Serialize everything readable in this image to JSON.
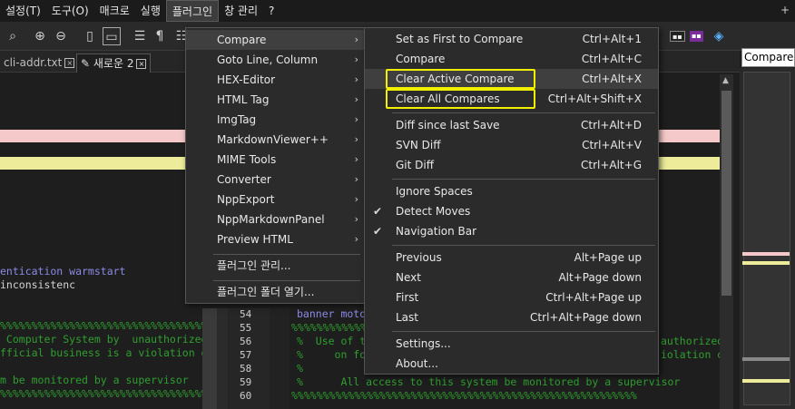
{
  "menubar": {
    "items": [
      "설정(T)",
      "도구(O)",
      "매크로",
      "실행",
      "플러그인",
      "창 관리",
      "?"
    ],
    "plus": "+"
  },
  "tabs": [
    {
      "label": "cli-addr.txt"
    },
    {
      "label": "새로운 2"
    }
  ],
  "compare_panel_tab": "Compare Pa",
  "plugin_menu": {
    "items": [
      {
        "label": "Compare",
        "submenu": true
      },
      {
        "label": "Goto Line, Column",
        "submenu": true
      },
      {
        "label": "HEX-Editor",
        "submenu": true
      },
      {
        "label": "HTML Tag",
        "submenu": true
      },
      {
        "label": "ImgTag",
        "submenu": true
      },
      {
        "label": "MarkdownViewer++",
        "submenu": true
      },
      {
        "label": "MIME Tools",
        "submenu": true
      },
      {
        "label": "Converter",
        "submenu": true
      },
      {
        "label": "NppExport",
        "submenu": true
      },
      {
        "label": "NppMarkdownPanel",
        "submenu": true
      },
      {
        "label": "Preview HTML",
        "submenu": true
      },
      {
        "label": "플러그인 관리...",
        "submenu": false
      },
      {
        "label": "플러그인 폴더 열기...",
        "submenu": false
      }
    ]
  },
  "compare_menu": {
    "items": [
      {
        "label": "Set as First to Compare",
        "shortcut": "Ctrl+Alt+1"
      },
      {
        "label": "Compare",
        "shortcut": "Ctrl+Alt+C"
      },
      {
        "label": "Clear Active Compare",
        "shortcut": "Ctrl+Alt+X"
      },
      {
        "label": "Clear All Compares",
        "shortcut": "Ctrl+Alt+Shift+X"
      },
      {
        "label": "Diff since last Save",
        "shortcut": "Ctrl+Alt+D"
      },
      {
        "label": "SVN Diff",
        "shortcut": "Ctrl+Alt+V"
      },
      {
        "label": "Git Diff",
        "shortcut": "Ctrl+Alt+G"
      },
      {
        "label": "Ignore Spaces",
        "shortcut": "",
        "checked": false
      },
      {
        "label": "Detect Moves",
        "shortcut": "",
        "checked": true
      },
      {
        "label": "Navigation Bar",
        "shortcut": "",
        "checked": true
      },
      {
        "label": "Previous",
        "shortcut": "Alt+Page up"
      },
      {
        "label": "Next",
        "shortcut": "Alt+Page down"
      },
      {
        "label": "First",
        "shortcut": "Ctrl+Alt+Page up"
      },
      {
        "label": "Last",
        "shortcut": "Ctrl+Alt+Page down"
      },
      {
        "label": "Settings...",
        "shortcut": ""
      },
      {
        "label": "About...",
        "shortcut": ""
      }
    ]
  },
  "editor": {
    "left_lines": [
      "entication warmstart",
      "inconsistenc",
      "%%%%%%%%%%%%%%%%%%%%%%%%%%%%%%%%%%%%%%%%%%%%%%%%%%%%%%%",
      " Computer System by  unauthorized",
      "fficial business is a violation o",
      "",
      "m be monitored by a supervisor",
      "%%%%%%%%%%%%%%%%%%%%%%%%%%%%%%%%%%%%%%%%%%%%%%%%%%%%%%%"
    ],
    "line_numbers": [
      "54",
      "55",
      "56",
      "57",
      "58",
      "59",
      "60"
    ],
    "right_lines": [
      "banner moto",
      "%%%%%%%%%%%%%%%%%%%%%%%%%%%%%%%%%%%%%%%%%%%%%%%%%%%%%%%",
      "%  Use of t",
      "%     on fo",
      "%",
      "%      All access to this system be monitored by a supervisor",
      "%%%%%%%%%%%%%%%%%%%%%%%%%%%%%%%%%%%%%%%%%%%%%%%%%%%%%%%"
    ],
    "right_overflow": [
      "authorized",
      "iolation o"
    ]
  },
  "colors": {
    "highlight_pink": "#f5c9c9",
    "highlight_yellow": "#ecec9a",
    "annotation_box": "#f0f000",
    "comment_green": "#2f9f2f"
  }
}
